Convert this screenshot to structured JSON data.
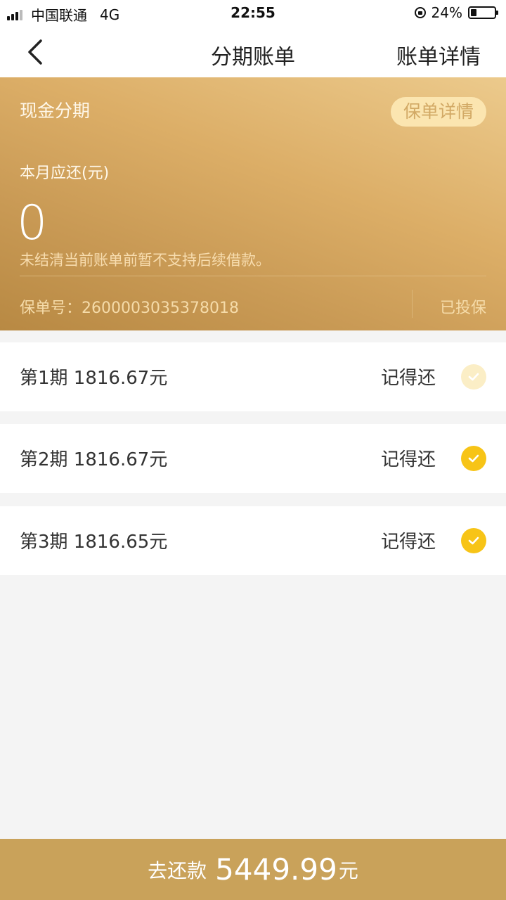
{
  "status_bar": {
    "carrier": "中国联通",
    "network": "4G",
    "time": "22:55",
    "battery": "24%",
    "battery_level": 0.24
  },
  "nav": {
    "title": "分期账单",
    "right_link": "账单详情"
  },
  "card": {
    "title": "现金分期",
    "policy_button": "保单详情",
    "due_label": "本月应还(元)",
    "due_amount": "0",
    "notice": "未结清当前账单前暂不支持后续借款。",
    "policy_number": "保单号：2600003035378018",
    "insured_status": "已投保"
  },
  "installments": [
    {
      "label": "第1期 1816.67元",
      "action": "记得还",
      "checked": false
    },
    {
      "label": "第2期 1816.67元",
      "action": "记得还",
      "checked": true
    },
    {
      "label": "第3期 1816.65元",
      "action": "记得还",
      "checked": true
    }
  ],
  "pay_bar": {
    "prefix": "去还款",
    "amount": "5449.99",
    "unit": "元"
  },
  "colors": {
    "accent_gold": "#c9a25a",
    "check_yellow": "#f7c417"
  }
}
